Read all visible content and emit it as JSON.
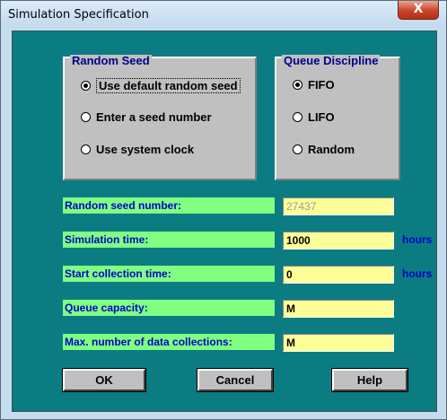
{
  "window": {
    "title": "Simulation Specification",
    "close_glyph": "X"
  },
  "random_seed": {
    "title": "Random Seed",
    "options": [
      {
        "label": "Use default random seed",
        "selected": true
      },
      {
        "label": "Enter a seed number",
        "selected": false
      },
      {
        "label": "Use system clock",
        "selected": false
      }
    ]
  },
  "queue_discipline": {
    "title": "Queue Discipline",
    "options": [
      {
        "label": "FIFO",
        "selected": true
      },
      {
        "label": "LIFO",
        "selected": false
      },
      {
        "label": "Random",
        "selected": false
      }
    ]
  },
  "fields": [
    {
      "label": "Random seed number:",
      "value": "27437",
      "unit": "",
      "disabled": true
    },
    {
      "label": "Simulation time:",
      "value": "1000",
      "unit": "hours",
      "disabled": false
    },
    {
      "label": "Start collection time:",
      "value": "0",
      "unit": "hours",
      "disabled": false
    },
    {
      "label": "Queue capacity:",
      "value": "M",
      "unit": "",
      "disabled": false
    },
    {
      "label": "Max. number of data collections:",
      "value": "M",
      "unit": "",
      "disabled": false
    }
  ],
  "buttons": {
    "ok": "OK",
    "cancel": "Cancel",
    "help": "Help"
  },
  "colors": {
    "client_bg": "#0b7c82",
    "label_bg": "#80ff80",
    "field_bg": "#ffff99",
    "label_text": "#0000cc",
    "group_title": "#00008b"
  }
}
